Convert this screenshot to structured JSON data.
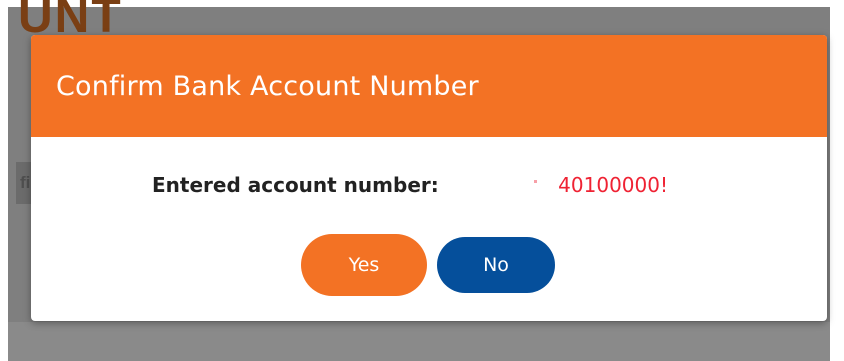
{
  "background": {
    "heading_fragment": "UNT",
    "tab_fragment": "fil"
  },
  "modal": {
    "title": "Confirm Bank Account Number",
    "entered_label": "Entered account number:",
    "account_number": "40100000!",
    "yes_label": "Yes",
    "no_label": "No"
  },
  "colors": {
    "header_accent": "#f37224",
    "yes_button": "#f37224",
    "no_button": "#054f9b",
    "account_number_text": "#ef2233"
  }
}
